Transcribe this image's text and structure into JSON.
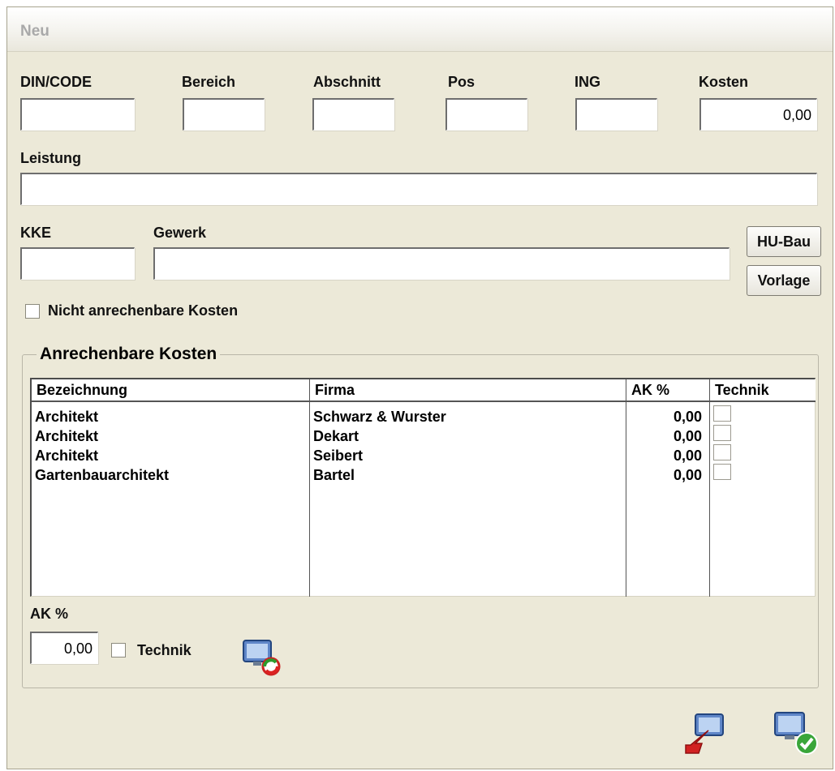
{
  "window": {
    "title": "Neu"
  },
  "fields": {
    "din_code": {
      "label": "DIN/CODE",
      "value": ""
    },
    "bereich": {
      "label": "Bereich",
      "value": ""
    },
    "abschnitt": {
      "label": "Abschnitt",
      "value": ""
    },
    "pos": {
      "label": "Pos",
      "value": ""
    },
    "ing": {
      "label": "ING",
      "value": ""
    },
    "kosten": {
      "label": "Kosten",
      "value": "0,00"
    },
    "leistung": {
      "label": "Leistung",
      "value": ""
    },
    "kke": {
      "label": "KKE",
      "value": ""
    },
    "gewerk": {
      "label": "Gewerk",
      "value": ""
    }
  },
  "buttons": {
    "hu_bau": "HU-Bau",
    "vorlage": "Vorlage"
  },
  "nicht_anrechenbar": {
    "label": "Nicht anrechenbare Kosten",
    "checked": false
  },
  "group": {
    "title": "Anrechenbare Kosten"
  },
  "table": {
    "columns": [
      "Bezeichnung",
      "Firma",
      "AK %",
      "Technik"
    ],
    "rows": [
      {
        "bezeichnung": "Architekt",
        "firma": "Schwarz & Wurster",
        "ak": "0,00",
        "technik": false
      },
      {
        "bezeichnung": "Architekt",
        "firma": "Dekart",
        "ak": "0,00",
        "technik": false
      },
      {
        "bezeichnung": "Architekt",
        "firma": "Seibert",
        "ak": "0,00",
        "technik": false
      },
      {
        "bezeichnung": "Gartenbauarchitekt",
        "firma": "Bartel",
        "ak": "0,00",
        "technik": false
      }
    ]
  },
  "ak_edit": {
    "label": "AK %",
    "value": "0,00",
    "technik_label": "Technik",
    "technik_checked": false
  },
  "icons": {
    "apply": "monitor-refresh-icon",
    "cancel": "monitor-back-arrow-icon",
    "ok": "monitor-checkmark-icon"
  },
  "colors": {
    "window_bg": "#ece9d8",
    "ok_green": "#3aa63a",
    "cancel_red": "#d22222"
  }
}
